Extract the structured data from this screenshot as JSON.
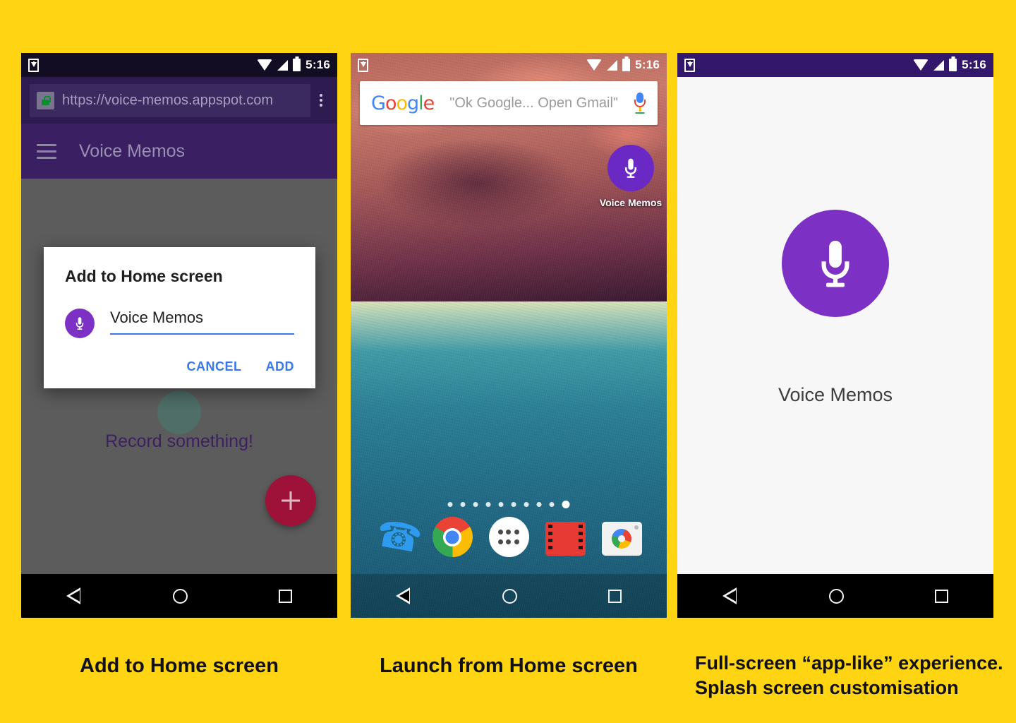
{
  "page": {
    "background_color": "#FFD413",
    "brand_purple": "#7D30C4"
  },
  "status_bar": {
    "time": "5:16",
    "icons": [
      "download-icon",
      "wifi-icon",
      "signal-icon",
      "battery-icon"
    ]
  },
  "panel1": {
    "caption": "Add to Home screen",
    "browser": {
      "url": "https://voice-memos.appspot.com",
      "lock_icon": "lock-icon",
      "menu_icon": "overflow-menu-icon"
    },
    "app_bar": {
      "title": "Voice Memos",
      "menu_icon": "hamburger-icon"
    },
    "content": {
      "empty_text": "Record something!",
      "fab_label": "+"
    },
    "dialog": {
      "title": "Add to Home screen",
      "icon": "microphone-icon",
      "input_value": "Voice Memos",
      "input_placeholder": "Voice Memos",
      "cancel_label": "CANCEL",
      "add_label": "ADD"
    },
    "nav": {
      "back": "back-icon",
      "home": "home-icon",
      "recents": "recents-icon"
    }
  },
  "panel2": {
    "caption": "Launch from Home screen",
    "search_widget": {
      "logo_g": "G",
      "logo_o1": "o",
      "logo_o2": "o",
      "logo_g2": "g",
      "logo_l": "l",
      "logo_e": "e",
      "hint": "\"Ok Google... Open Gmail\"",
      "mic_icon": "google-mic-icon"
    },
    "shortcut": {
      "label": "Voice Memos",
      "icon": "microphone-icon"
    },
    "page_indicator": {
      "count": 10,
      "active_index": 9
    },
    "dock": [
      {
        "name": "phone",
        "icon": "phone-icon"
      },
      {
        "name": "chrome",
        "icon": "chrome-icon"
      },
      {
        "name": "app-drawer",
        "icon": "app-drawer-icon"
      },
      {
        "name": "play-movies",
        "icon": "play-movies-icon"
      },
      {
        "name": "camera",
        "icon": "camera-icon"
      }
    ]
  },
  "panel3": {
    "caption_line1": "Full-screen “app-like” experience.",
    "caption_line2": "Splash screen customisation",
    "splash": {
      "icon": "microphone-icon",
      "label": "Voice Memos"
    }
  }
}
